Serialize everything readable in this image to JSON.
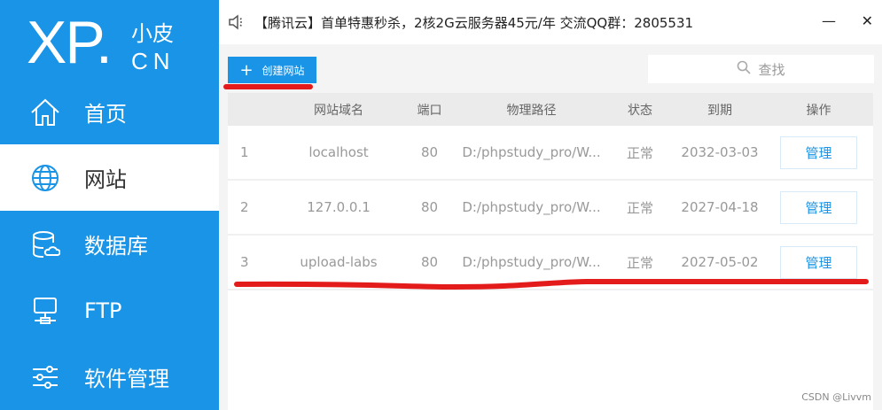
{
  "logo": {
    "main": "XP",
    "dot": ".",
    "cn_top": "小皮",
    "cn_bottom": "CN"
  },
  "nav": [
    {
      "label": "首页",
      "icon": "home-icon"
    },
    {
      "label": "网站",
      "icon": "globe-icon"
    },
    {
      "label": "数据库",
      "icon": "database-icon"
    },
    {
      "label": "FTP",
      "icon": "ftp-icon"
    },
    {
      "label": "软件管理",
      "icon": "settings-sliders-icon"
    }
  ],
  "notice": "【腾讯云】首单特惠秒杀，2核2G云服务器45元/年 交流QQ群：2805531",
  "window": {
    "minimize": "—",
    "close": "✕"
  },
  "create_button": "创建网站",
  "search_placeholder": "查找",
  "table": {
    "headers": [
      "网站域名",
      "端口",
      "物理路径",
      "状态",
      "到期",
      "操作"
    ],
    "rows": [
      {
        "index": "1",
        "domain": "localhost",
        "port": "80",
        "path": "D:/phpstudy_pro/W...",
        "status": "正常",
        "expires": "2032-03-03",
        "action": "管理"
      },
      {
        "index": "2",
        "domain": "127.0.0.1",
        "port": "80",
        "path": "D:/phpstudy_pro/W...",
        "status": "正常",
        "expires": "2027-04-18",
        "action": "管理"
      },
      {
        "index": "3",
        "domain": "upload-labs",
        "port": "80",
        "path": "D:/phpstudy_pro/W...",
        "status": "正常",
        "expires": "2027-05-02",
        "action": "管理"
      }
    ]
  },
  "watermark": "CSDN @Livvm",
  "colors": {
    "accent": "#1a94e6",
    "annotation": "#e31b1b"
  }
}
